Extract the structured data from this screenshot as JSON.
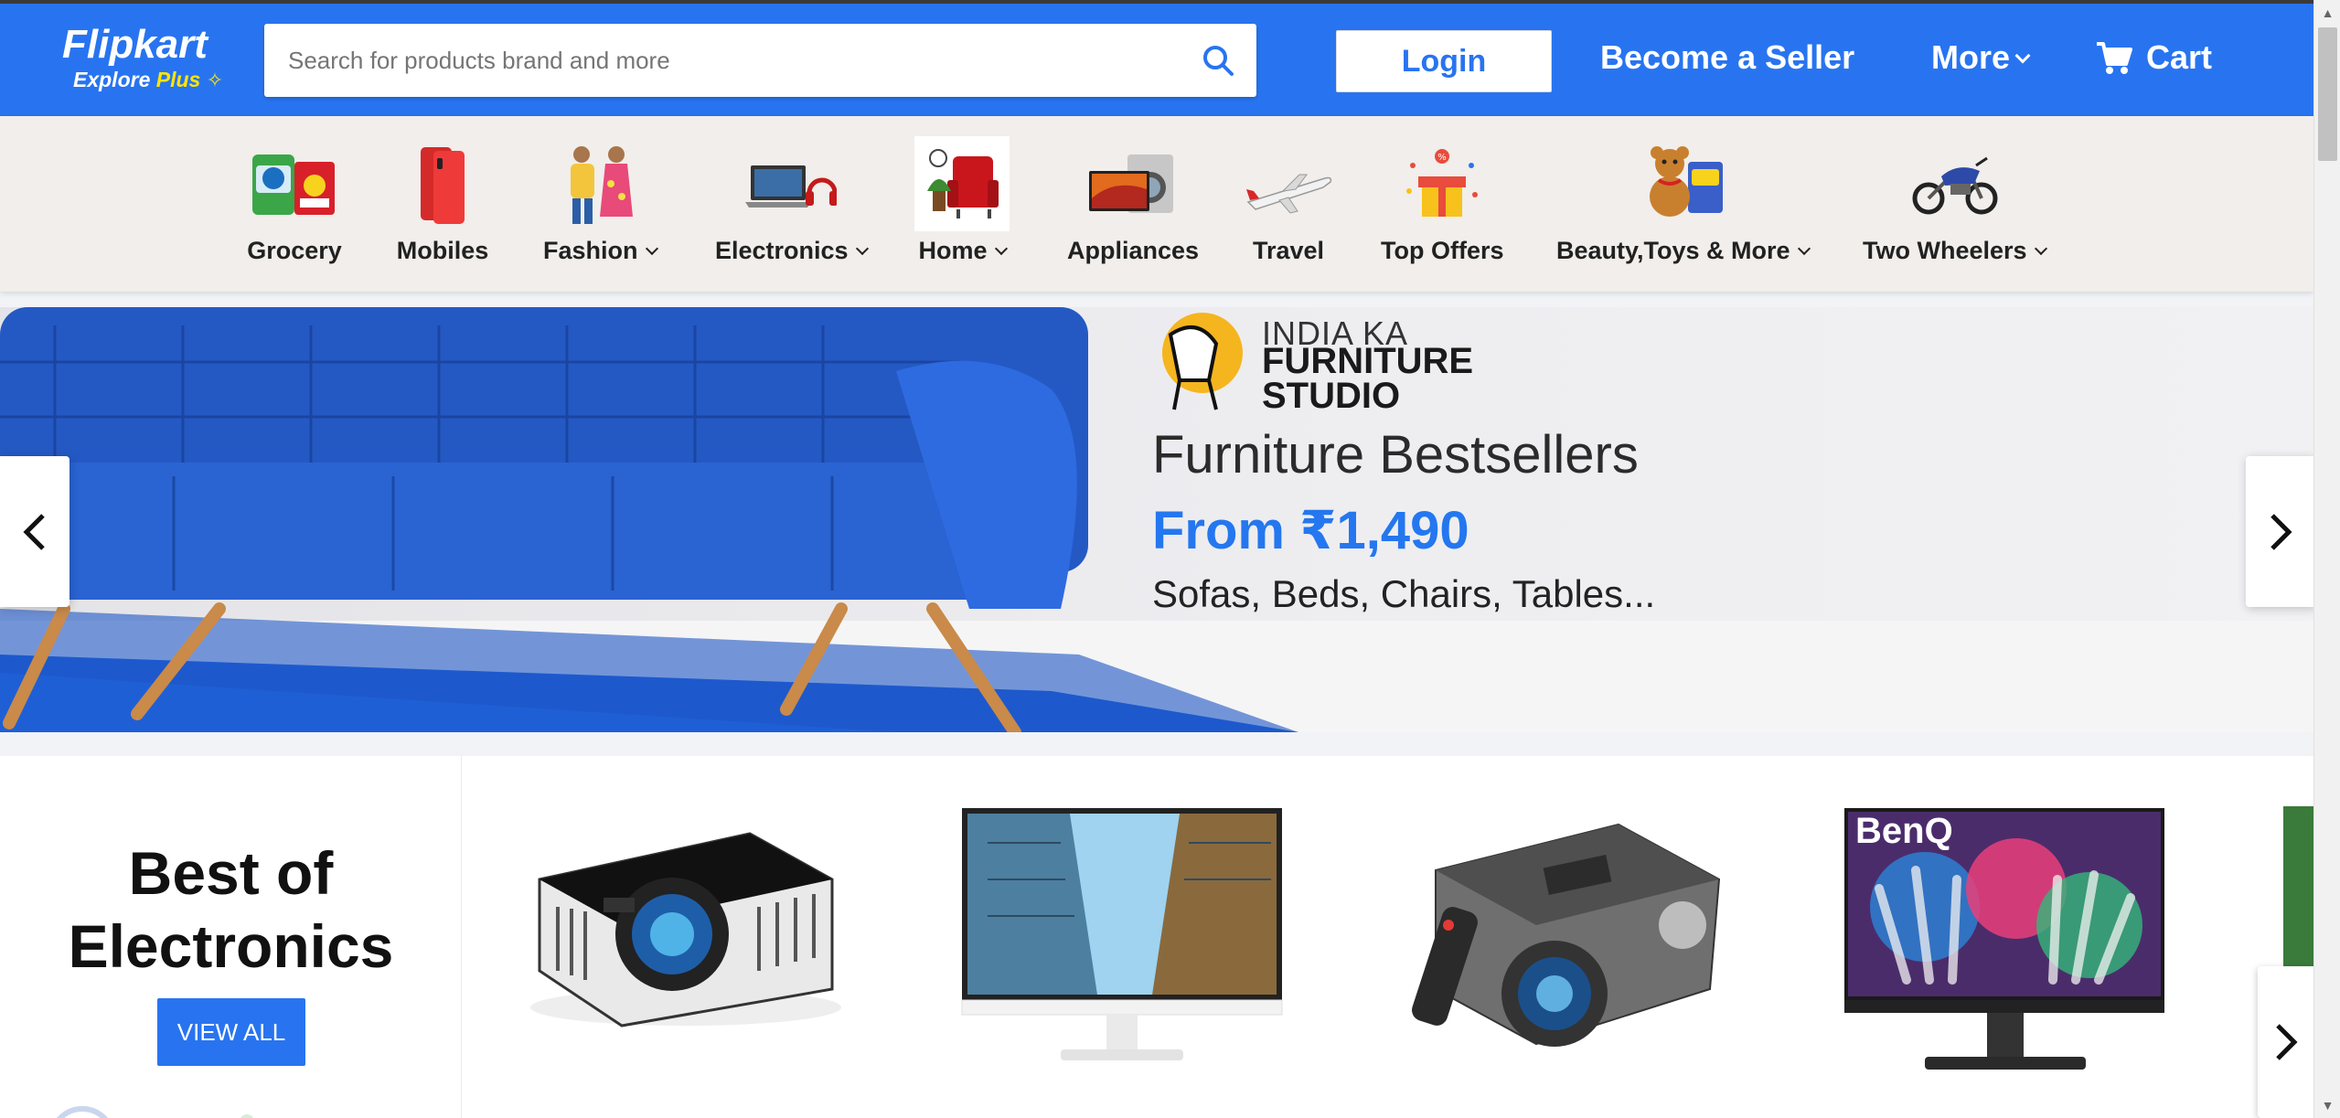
{
  "header": {
    "logo_text": "Flipkart",
    "logo_sub": "Explore",
    "logo_plus": "Plus",
    "search_placeholder": "Search for products brand and more",
    "login_label": "Login",
    "seller_label": "Become a Seller",
    "more_label": "More",
    "cart_label": "Cart",
    "brand_color": "#2874f0",
    "accent_color": "#ffe500"
  },
  "categories": [
    {
      "label": "Grocery",
      "icon": "grocery-icon",
      "dropdown": false
    },
    {
      "label": "Mobiles",
      "icon": "mobiles-icon",
      "dropdown": false
    },
    {
      "label": "Fashion",
      "icon": "fashion-icon",
      "dropdown": true
    },
    {
      "label": "Electronics",
      "icon": "electronics-icon",
      "dropdown": true
    },
    {
      "label": "Home",
      "icon": "home-icon",
      "dropdown": true
    },
    {
      "label": "Appliances",
      "icon": "appliances-icon",
      "dropdown": false
    },
    {
      "label": "Travel",
      "icon": "travel-icon",
      "dropdown": false
    },
    {
      "label": "Top Offers",
      "icon": "top-offers-icon",
      "dropdown": false
    },
    {
      "label": "Beauty,Toys & More",
      "icon": "beauty-toys-icon",
      "dropdown": true
    },
    {
      "label": "Two Wheelers",
      "icon": "two-wheelers-icon",
      "dropdown": true
    }
  ],
  "banner": {
    "studio_line1": "INDIA KA",
    "studio_line2": "FURNITURE",
    "studio_line3": "STUDIO",
    "title": "Furniture Bestsellers",
    "price": "From ₹1,490",
    "subtitle": "Sofas, Beds, Chairs, Tables..."
  },
  "section": {
    "title_line1": "Best of",
    "title_line2": "Electronics",
    "view_all_label": "VIEW ALL",
    "products": [
      {
        "icon": "projector-icon"
      },
      {
        "icon": "monitor-icon"
      },
      {
        "icon": "projector-icon"
      },
      {
        "icon": "monitor-icon",
        "brand": "BenQ"
      }
    ]
  }
}
